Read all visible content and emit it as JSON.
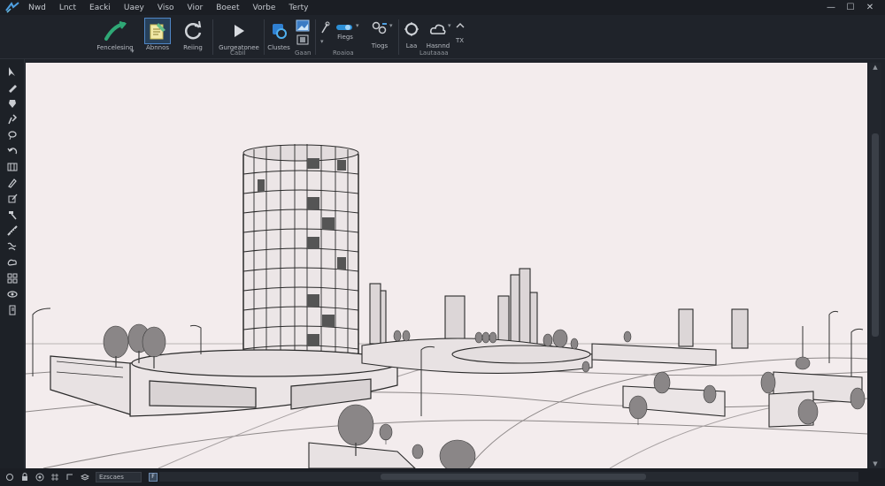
{
  "menu": {
    "items": [
      "Nwd",
      "Lnct",
      "Eacki",
      "Uaey",
      "Viso",
      "Vior",
      "Boeet",
      "Vorbe",
      "Terty"
    ]
  },
  "window": {
    "minimize": "—",
    "restore": "☐",
    "close": "✕"
  },
  "ribbon": {
    "buttons": {
      "b1": "Fencelesing",
      "b2": "Abnnos",
      "b3": "Reiing",
      "b4": "Gurgeatonee",
      "b5": "Clustes",
      "b6": "Fiegs",
      "b7": "Tiogs",
      "b8": "Laa",
      "b9": "Hasnnd",
      "b10": "TX"
    },
    "groups": {
      "g1": "Cabil",
      "g2": "Gaan",
      "g3": "Roaioa",
      "g4": "Lautaaaa"
    },
    "dropdown_mark": "▾"
  },
  "status": {
    "field": "Ezscaes",
    "toggle": "F"
  },
  "colors": {
    "accent": "#4f86c6",
    "background": "#1f232a",
    "viewport": "#f3eced",
    "active_tool": "#27405a"
  },
  "icons": [
    "app-logo-icon",
    "pen-curve-icon",
    "annotate-icon",
    "rotate-icon",
    "play-icon",
    "gear-icon",
    "image-icon",
    "wand-icon",
    "toggle-icon",
    "layers-icon",
    "ring-icon",
    "cloud-icon",
    "chevron-up-icon"
  ]
}
